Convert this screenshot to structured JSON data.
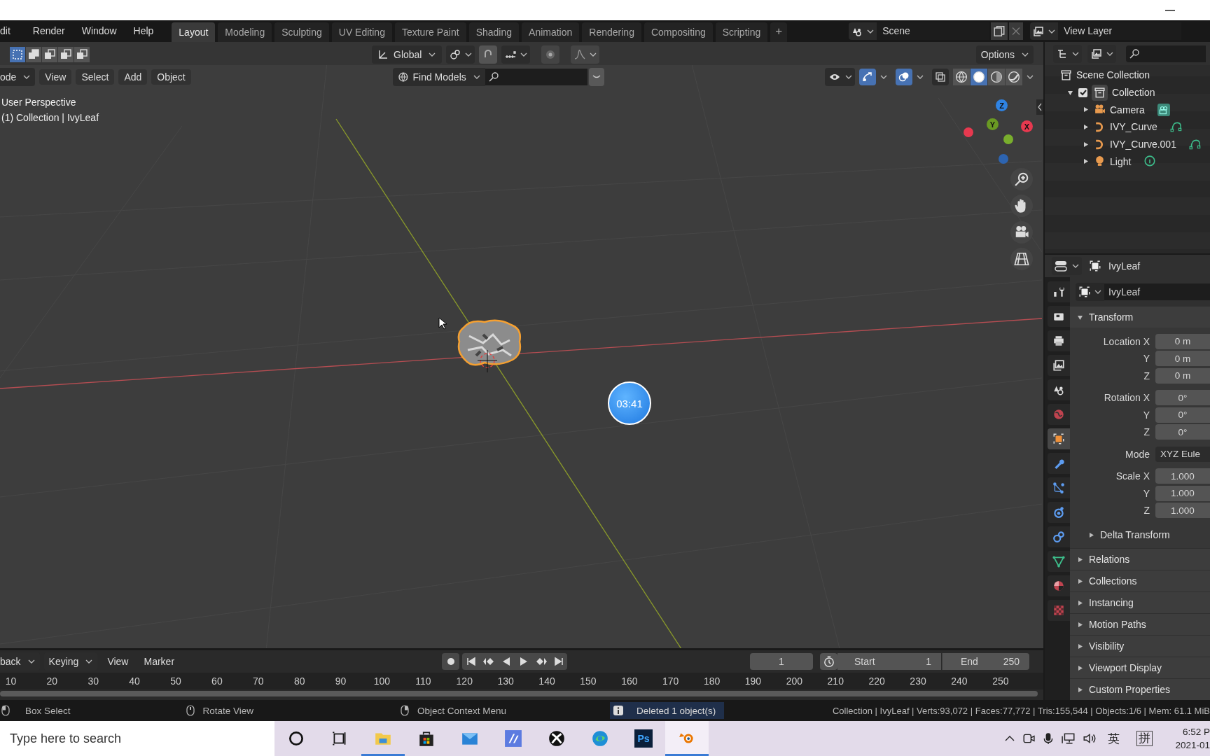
{
  "menu": [
    "dit",
    "Render",
    "Window",
    "Help"
  ],
  "workspace_tabs": [
    {
      "label": "Layout",
      "selected": true
    },
    {
      "label": "Modeling",
      "selected": false
    },
    {
      "label": "Sculpting",
      "selected": false
    },
    {
      "label": "UV Editing",
      "selected": false
    },
    {
      "label": "Texture Paint",
      "selected": false
    },
    {
      "label": "Shading",
      "selected": false
    },
    {
      "label": "Animation",
      "selected": false
    },
    {
      "label": "Rendering",
      "selected": false
    },
    {
      "label": "Compositing",
      "selected": false
    },
    {
      "label": "Scripting",
      "selected": false
    }
  ],
  "add_tab": "+",
  "scene": {
    "name": "Scene"
  },
  "view_layer": {
    "name": "View Layer"
  },
  "viewport": {
    "select_modes": [
      {
        "selected": true
      },
      {
        "selected": false
      },
      {
        "selected": false
      },
      {
        "selected": false
      },
      {
        "selected": false
      }
    ],
    "transform_orientation": "Global",
    "options": "Options",
    "mode": "ode",
    "menus": [
      "View",
      "Select",
      "Add",
      "Object"
    ],
    "asset_dropdown": "Find Models",
    "gizmos": {
      "on": true
    },
    "overlays": {
      "on": true
    },
    "xray": {
      "on": false
    },
    "shading_modes": [
      {
        "kind": "wireframe",
        "selected": false
      },
      {
        "kind": "solid",
        "selected": true
      },
      {
        "kind": "material",
        "selected": false
      },
      {
        "kind": "rendered",
        "selected": false
      }
    ],
    "info": [
      "User Perspective",
      "(1) Collection | IvyLeaf"
    ],
    "gizmo_axes": [
      {
        "label": "Z",
        "color": "#2f83e3"
      },
      {
        "label": "Y",
        "color": "#6a9a23"
      },
      {
        "label": "X",
        "color": "#e6394f"
      }
    ],
    "timer": "03:41"
  },
  "outliner": {
    "tree": [
      {
        "label": "Scene Collection",
        "kind": "scene_collection",
        "children": [
          {
            "label": "Collection",
            "kind": "collection",
            "expanded": true,
            "checked": true,
            "children": [
              {
                "label": "Camera",
                "kind": "camera",
                "expanded": false
              },
              {
                "label": "IVY_Curve",
                "kind": "curve",
                "expanded": false
              },
              {
                "label": "IVY_Curve.001",
                "kind": "curve",
                "expanded": false
              },
              {
                "label": "Light",
                "kind": "light",
                "expanded": false
              }
            ]
          }
        ]
      }
    ]
  },
  "properties": {
    "object": "IvyLeaf",
    "datablock": "IvyLeaf",
    "tabs": [
      {
        "kind": "tool",
        "selected": false
      },
      {
        "kind": "render",
        "selected": false
      },
      {
        "kind": "output",
        "selected": false
      },
      {
        "kind": "view_layer",
        "selected": false
      },
      {
        "kind": "scene",
        "selected": false
      },
      {
        "kind": "world",
        "selected": false
      },
      {
        "kind": "object",
        "selected": true
      },
      {
        "kind": "modifiers",
        "selected": false
      },
      {
        "kind": "particles",
        "selected": false
      },
      {
        "kind": "physics",
        "selected": false
      },
      {
        "kind": "constraints",
        "selected": false
      },
      {
        "kind": "data",
        "selected": false
      },
      {
        "kind": "material",
        "selected": false
      },
      {
        "kind": "texture",
        "selected": false
      }
    ],
    "transform": {
      "title": "Transform",
      "expanded": true,
      "groups": [
        {
          "kind": "number",
          "rows": [
            {
              "label": "Location X",
              "value": "0 m"
            },
            {
              "label": "Y",
              "value": "0 m"
            },
            {
              "label": "Z",
              "value": "0 m"
            }
          ]
        },
        {
          "kind": "number",
          "rows": [
            {
              "label": "Rotation X",
              "value": "0°"
            },
            {
              "label": "Y",
              "value": "0°"
            },
            {
              "label": "Z",
              "value": "0°"
            }
          ]
        },
        {
          "kind": "dropdown",
          "rows": [
            {
              "label": "Mode",
              "value": "XYZ Eule"
            }
          ]
        },
        {
          "kind": "number",
          "rows": [
            {
              "label": "Scale X",
              "value": "1.000"
            },
            {
              "label": "Y",
              "value": "1.000"
            },
            {
              "label": "Z",
              "value": "1.000"
            }
          ]
        }
      ],
      "subpanel": {
        "title": "Delta Transform",
        "expanded": false
      }
    },
    "panels": [
      {
        "title": "Relations",
        "expanded": false
      },
      {
        "title": "Collections",
        "expanded": false
      },
      {
        "title": "Instancing",
        "expanded": false
      },
      {
        "title": "Motion Paths",
        "expanded": false
      },
      {
        "title": "Visibility",
        "expanded": false
      },
      {
        "title": "Viewport Display",
        "expanded": false
      },
      {
        "title": "Custom Properties",
        "expanded": false
      }
    ]
  },
  "timeline": {
    "menus": [
      {
        "label": "back",
        "kind": "dropdown"
      },
      {
        "label": "Keying",
        "kind": "dropdown"
      },
      {
        "label": "View",
        "kind": "menu"
      },
      {
        "label": "Marker",
        "kind": "menu"
      }
    ],
    "current_frame": "1",
    "start_label": "Start",
    "start": "1",
    "end_label": "End",
    "end": "250",
    "ticks": [
      "10",
      "20",
      "30",
      "40",
      "50",
      "60",
      "70",
      "80",
      "90",
      "100",
      "110",
      "120",
      "130",
      "140",
      "150",
      "160",
      "170",
      "180",
      "190",
      "200",
      "210",
      "220",
      "230",
      "240",
      "250"
    ]
  },
  "status_bar": {
    "hints": [
      {
        "kind": "left",
        "label": "Box Select"
      },
      {
        "kind": "middle",
        "label": "Rotate View"
      },
      {
        "kind": "right",
        "label": "Object Context Menu"
      }
    ],
    "report": "Deleted 1 object(s)",
    "stats": "Collection | IvyLeaf | Verts:93,072 | Faces:77,772 | Tris:155,544 | Objects:1/6 | Mem: 61.1 MiB"
  },
  "taskbar": {
    "search_placeholder": "Type here to search",
    "apps": [
      {
        "kind": "cortana",
        "running": false,
        "selected": false
      },
      {
        "kind": "task_view",
        "running": false,
        "selected": false
      },
      {
        "kind": "explorer",
        "running": true,
        "selected": false
      },
      {
        "kind": "store",
        "running": false,
        "selected": false
      },
      {
        "kind": "mail",
        "running": false,
        "selected": false
      },
      {
        "kind": "app",
        "running": false,
        "selected": false
      },
      {
        "kind": "xbox",
        "running": false,
        "selected": false
      },
      {
        "kind": "edge",
        "running": false,
        "selected": false
      },
      {
        "kind": "photoshop",
        "label": "Ps",
        "running": false,
        "selected": false
      },
      {
        "kind": "blender",
        "running": true,
        "selected": true
      }
    ],
    "ime": [
      "英",
      "拼"
    ],
    "time": "6:52 P",
    "date": "2021-01"
  }
}
